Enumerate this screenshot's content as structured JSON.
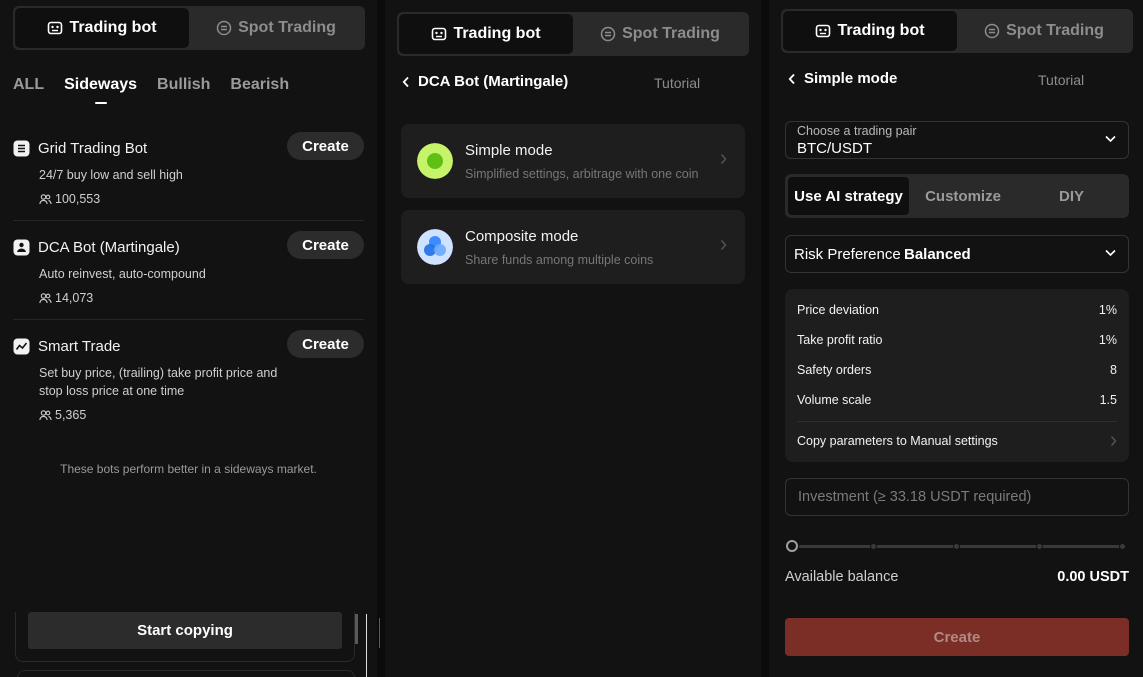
{
  "colors": {
    "accent_create": "#7a2e26",
    "simple_icon": "#c6f36a",
    "composite_icon": "#3d8bff"
  },
  "top_toggle": {
    "trading_bot": "Trading bot",
    "spot_trading": "Spot Trading"
  },
  "panel1": {
    "filters": [
      "ALL",
      "Sideways",
      "Bullish",
      "Bearish"
    ],
    "active_filter": "Sideways",
    "bots": [
      {
        "name": "Grid Trading Bot",
        "desc": "24/7 buy low and sell high",
        "users": "100,553",
        "action": "Create",
        "icon": "grid-bot-icon"
      },
      {
        "name": "DCA Bot (Martingale)",
        "desc": "Auto reinvest, auto-compound",
        "users": "14,073",
        "action": "Create",
        "icon": "dca-bot-icon"
      },
      {
        "name": "Smart Trade",
        "desc": "Set buy price, (trailing) take profit price and stop loss price at one time",
        "users": "5,365",
        "action": "Create",
        "icon": "smart-trade-icon"
      }
    ],
    "note": "These bots perform better in a sideways market.",
    "start_copying": "Start copying"
  },
  "panel2": {
    "back_title": "DCA Bot (Martingale)",
    "tutorial": "Tutorial",
    "modes": [
      {
        "title": "Simple mode",
        "subtitle": "Simplified settings, arbitrage with one coin"
      },
      {
        "title": "Composite mode",
        "subtitle": "Share funds among multiple coins"
      }
    ]
  },
  "panel3": {
    "back_title": "Simple mode",
    "tutorial": "Tutorial",
    "pair_label": "Choose a trading pair",
    "pair_value": "BTC/USDT",
    "strategies": [
      "Use AI strategy",
      "Customize",
      "DIY"
    ],
    "active_strategy": "Use AI strategy",
    "risk_label": "Risk Preference",
    "risk_value": "Balanced",
    "params": [
      {
        "label": "Price deviation",
        "value": "1%"
      },
      {
        "label": "Take profit ratio",
        "value": "1%"
      },
      {
        "label": "Safety orders",
        "value": "8"
      },
      {
        "label": "Volume scale",
        "value": "1.5"
      }
    ],
    "copy_params": "Copy parameters to Manual settings",
    "investment_placeholder": "Investment (≥ 33.18 USDT required)",
    "slider_percent": 0,
    "available_label": "Available balance",
    "available_value": "0.00 USDT",
    "create": "Create"
  }
}
